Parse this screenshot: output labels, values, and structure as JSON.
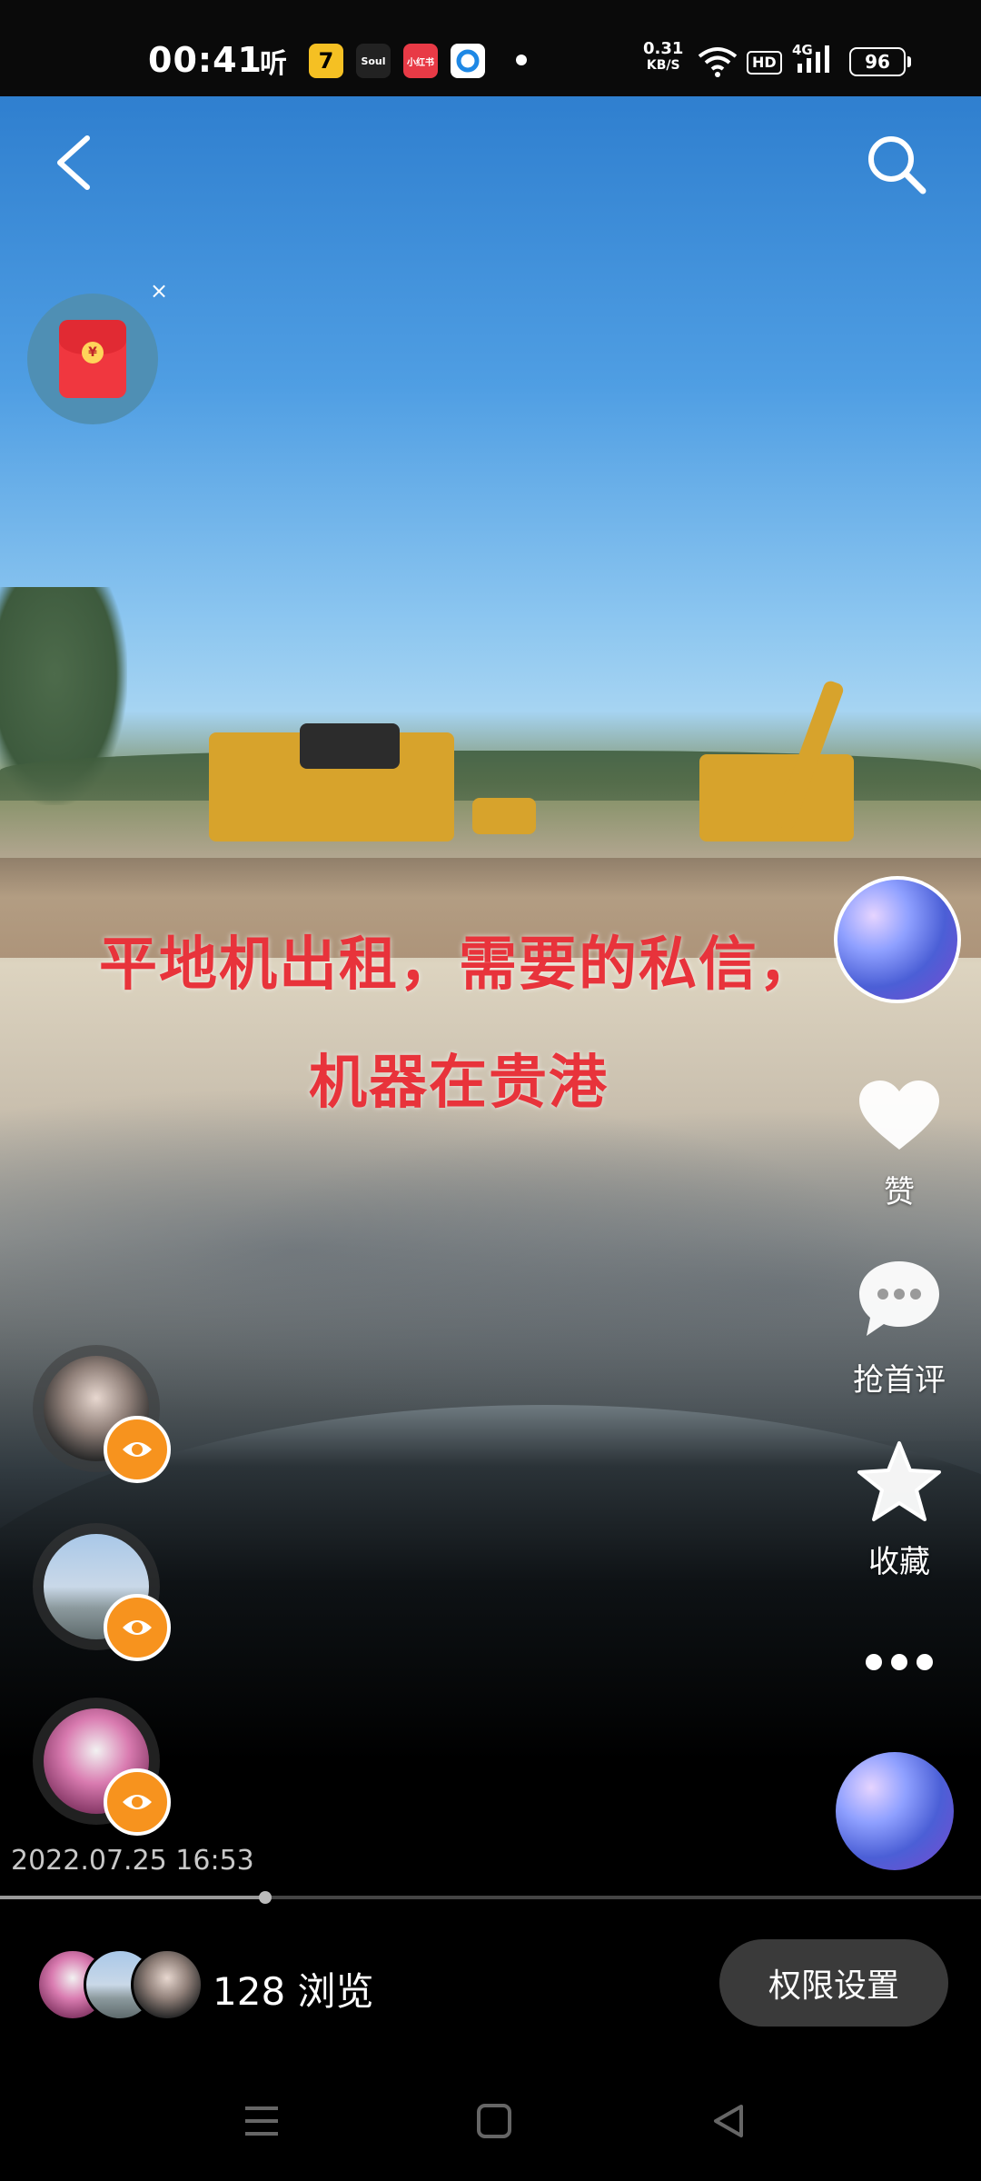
{
  "status_bar": {
    "time": "00:41",
    "apps": [
      "听",
      "7",
      "Soul",
      "小红书",
      "app"
    ],
    "net_speed_value": "0.31",
    "net_speed_unit": "KB/S",
    "hd": "HD",
    "network": "4G",
    "battery": "96"
  },
  "video": {
    "caption_line1": "平地机出租，需要的私信，",
    "caption_line2": "机器在贵港",
    "timestamp": "2022.07.25 16:53",
    "red_packet_symbol": "¥",
    "red_packet_close": "×"
  },
  "actions": {
    "like_label": "赞",
    "comment_label": "抢首评",
    "favorite_label": "收藏"
  },
  "footer": {
    "views_text": "128 浏览",
    "permission_button": "权限设置"
  },
  "progress_fraction": 0.27,
  "colors": {
    "caption": "#e8333b",
    "eye_badge": "#f7931e",
    "red_packet": "#f0373f"
  }
}
